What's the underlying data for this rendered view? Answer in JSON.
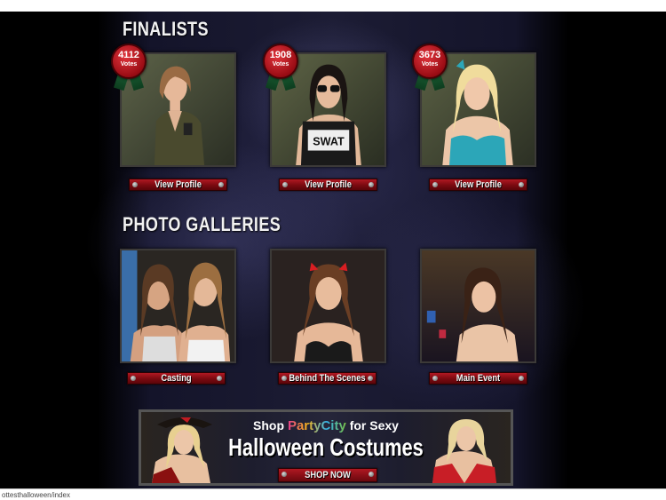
{
  "finalists": {
    "title": "FINALISTS",
    "items": [
      {
        "votes": "4112",
        "votes_label": "Votes",
        "button": "View Profile"
      },
      {
        "votes": "1908",
        "votes_label": "Votes",
        "button": "View Profile"
      },
      {
        "votes": "3673",
        "votes_label": "Votes",
        "button": "View Profile"
      }
    ]
  },
  "galleries": {
    "title": "PHOTO GALLERIES",
    "items": [
      {
        "button": "Casting"
      },
      {
        "button": "Behind The Scenes"
      },
      {
        "button": "Main Event"
      }
    ]
  },
  "banner": {
    "shop": "Shop",
    "brand": "PartyCity",
    "for_sexy": "for Sexy",
    "headline": "Halloween Costumes",
    "cta": "SHOP NOW"
  },
  "finalist_shirt_text": "SWAT",
  "status_bar": {
    "url": "ottesthalloween/index"
  },
  "colors": {
    "button_red": "#9a0c14",
    "badge_red": "#d42a32",
    "ribbon_green": "#1f6a3a",
    "background": "#000000"
  }
}
